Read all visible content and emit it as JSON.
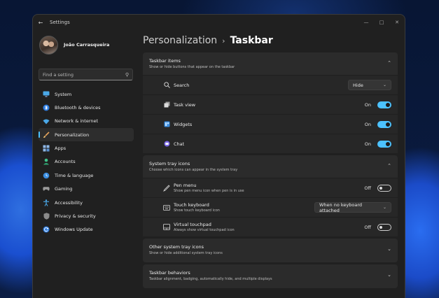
{
  "window": {
    "title": "Settings"
  },
  "profile": {
    "name": "João Carrasqueira"
  },
  "search": {
    "placeholder": "Find a setting"
  },
  "sidebar": {
    "items": [
      {
        "label": "System",
        "icon": "monitor-icon"
      },
      {
        "label": "Bluetooth & devices",
        "icon": "bluetooth-icon"
      },
      {
        "label": "Network & internet",
        "icon": "wifi-icon"
      },
      {
        "label": "Personalization",
        "icon": "brush-icon",
        "active": true
      },
      {
        "label": "Apps",
        "icon": "apps-icon"
      },
      {
        "label": "Accounts",
        "icon": "person-icon"
      },
      {
        "label": "Time & language",
        "icon": "clock-globe-icon"
      },
      {
        "label": "Gaming",
        "icon": "gamepad-icon"
      },
      {
        "label": "Accessibility",
        "icon": "accessibility-icon"
      },
      {
        "label": "Privacy & security",
        "icon": "shield-icon"
      },
      {
        "label": "Windows Update",
        "icon": "update-icon"
      }
    ]
  },
  "breadcrumb": {
    "parent": "Personalization",
    "separator": "›",
    "current": "Taskbar"
  },
  "sections": {
    "taskbar_items": {
      "title": "Taskbar items",
      "desc": "Show or hide buttons that appear on the taskbar",
      "rows": {
        "search": {
          "label": "Search",
          "value": "Hide"
        },
        "task_view": {
          "label": "Task view",
          "state": "On"
        },
        "widgets": {
          "label": "Widgets",
          "state": "On"
        },
        "chat": {
          "label": "Chat",
          "state": "On"
        }
      }
    },
    "system_tray": {
      "title": "System tray icons",
      "desc": "Choose which icons can appear in the system tray",
      "rows": {
        "pen_menu": {
          "label": "Pen menu",
          "sub": "Show pen menu icon when pen is in use",
          "state": "Off"
        },
        "touch_keyboard": {
          "label": "Touch keyboard",
          "sub": "Show touch keyboard icon",
          "value": "When no keyboard attached"
        },
        "virtual_touchpad": {
          "label": "Virtual touchpad",
          "sub": "Always show virtual touchpad icon",
          "state": "Off"
        }
      }
    },
    "other_tray": {
      "title": "Other system tray icons",
      "desc": "Show or hide additional system tray icons"
    },
    "behaviors": {
      "title": "Taskbar behaviors",
      "desc": "Taskbar alignment, badging, automatically hide, and multiple displays"
    }
  },
  "colors": {
    "accent": "#4cc2ff",
    "window_bg": "#202020",
    "card_bg": "#2b2b2b"
  }
}
